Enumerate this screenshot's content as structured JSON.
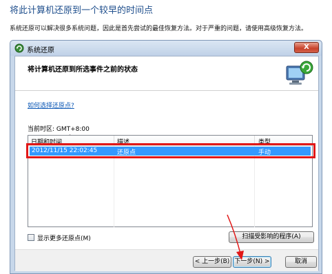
{
  "page": {
    "title": "将此计算机还原到一个较早的时间点",
    "description": "系统还原可以解决很多系统问题，因此是首先尝试的最佳恢复方法。对于严重的问题，请使用高级恢复方法。"
  },
  "dialog": {
    "title": "系统还原",
    "close_label": "X",
    "header_title": "将计算机还原到所选事件之前的状态",
    "help_link": "如何选择还原点?",
    "timezone_label": "当前时区: GMT+8:00",
    "columns": [
      "日期和时间",
      "描述",
      "类型"
    ],
    "sort_arrow": "^",
    "rows": [
      {
        "datetime": "2012/11/15 22:02:45",
        "description": "还原点",
        "type": "手动"
      }
    ],
    "show_more_label": "显示更多还原点(M)",
    "scan_button": "扫描受影响的程序(A)",
    "back_button": "< 上一步(B)",
    "next_button": "下一步(N) >",
    "cancel_button": "取消"
  },
  "colors": {
    "selection": "#3399ff",
    "annotation": "#e11717",
    "title": "#1e4e8c",
    "link": "#0b57b5"
  }
}
